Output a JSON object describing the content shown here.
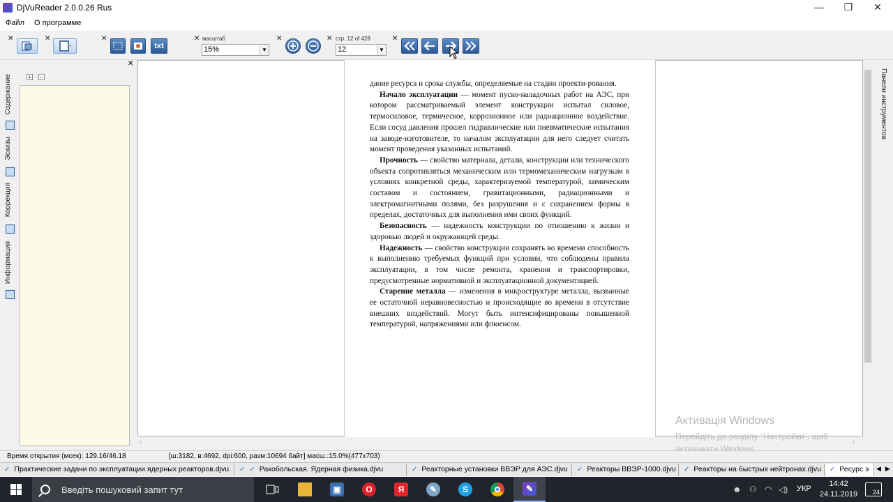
{
  "window": {
    "title": "DjVuReader 2.0.0.26 Rus",
    "minimize": "—",
    "restore": "❐",
    "close": "✕"
  },
  "menu": [
    "Файл",
    "О программе"
  ],
  "toolbar": {
    "zoom_label": "масштаб",
    "zoom_value": "15%",
    "page_label": "стр. 12 of 428",
    "page_value": "12",
    "text_button": "txt"
  },
  "sidetabs": [
    "Содержание",
    "Эскизы",
    "Коррекция",
    "Информация"
  ],
  "righttab": "Панели инструментов",
  "page": {
    "paragraphs": [
      {
        "bold": "",
        "text": "дание ресурса и срока службы, определяемые на стадии проекти-рования."
      },
      {
        "bold": "Начало эксплуатации",
        "text": " — момент пуско-наладочных работ на АЭС, при котором рассматриваемый элемент конструкции испытал силовое, термосиловое, термическое, коррозионное или радиационное воздействие. Если сосуд давления прошел гидравлические или пневматические испытания на заводе-изготовителе, то началом эксплуатации для него следует считать момент проведения указанных испытаний."
      },
      {
        "bold": "Прочность",
        "text": " — свойство материала, детали, конструкции или технического объекта сопротивляться механическим или термомеханическим нагрузкам в условиях конкретной среды, характеризуемой температурой, химическим составом и состоянием, гравитационными, радиационными и электромагнитными полями, без разрушения и с сохранением формы в пределах, достаточных для выполнения ими своих функций."
      },
      {
        "bold": "Безопасность",
        "text": " — надежность конструкции по отношению к жизни и здоровью людей и окружающей среды."
      },
      {
        "bold": "Надежность",
        "text": " — свойство конструкции сохранять во времени способность к выполнению требуемых функций при условии, что соблюдены правила эксплуатации, в том числе ремонта, хранения и транспортировки, предусмотренные нормативной и эксплуатационной документацией."
      },
      {
        "bold": "Старение металла",
        "text": " — изменения в микроструктуре металла, вызванные ее остаточной неравновесностью и происходящие во времени в отсутствие внешних воздействий. Могут быть интенсифицированы повышенной температурой, напряжениями или флюенсом."
      }
    ]
  },
  "watermark": {
    "title": "Активація Windows",
    "text": "Перейдіть до розділу \"Настройки\", щоб активувати Windows."
  },
  "status": {
    "open_time": "Время открытия (мсек): 129.16/46.18",
    "info": "[ш:3182, в:4692, dpi:600, разм:10694 байт] масш.:15.0%(477x703)"
  },
  "doc_tabs": [
    "Практические задачи по эксплуатации ядерных реакторов.djvu",
    "Ракобольская. Ядерная физика.djvu",
    "Реакторные установки ВВЭР для АЭС.djvu",
    "Реакторы ВВЭР-1000.djvu",
    "Реакторы на быстрых нейтронах.djvu",
    "Ресурс э"
  ],
  "taskbar": {
    "search_placeholder": "Введіть пошуковий запит тут",
    "language": "УКР",
    "time": "14:42",
    "date": "24.11.2019",
    "notifications": "24"
  }
}
